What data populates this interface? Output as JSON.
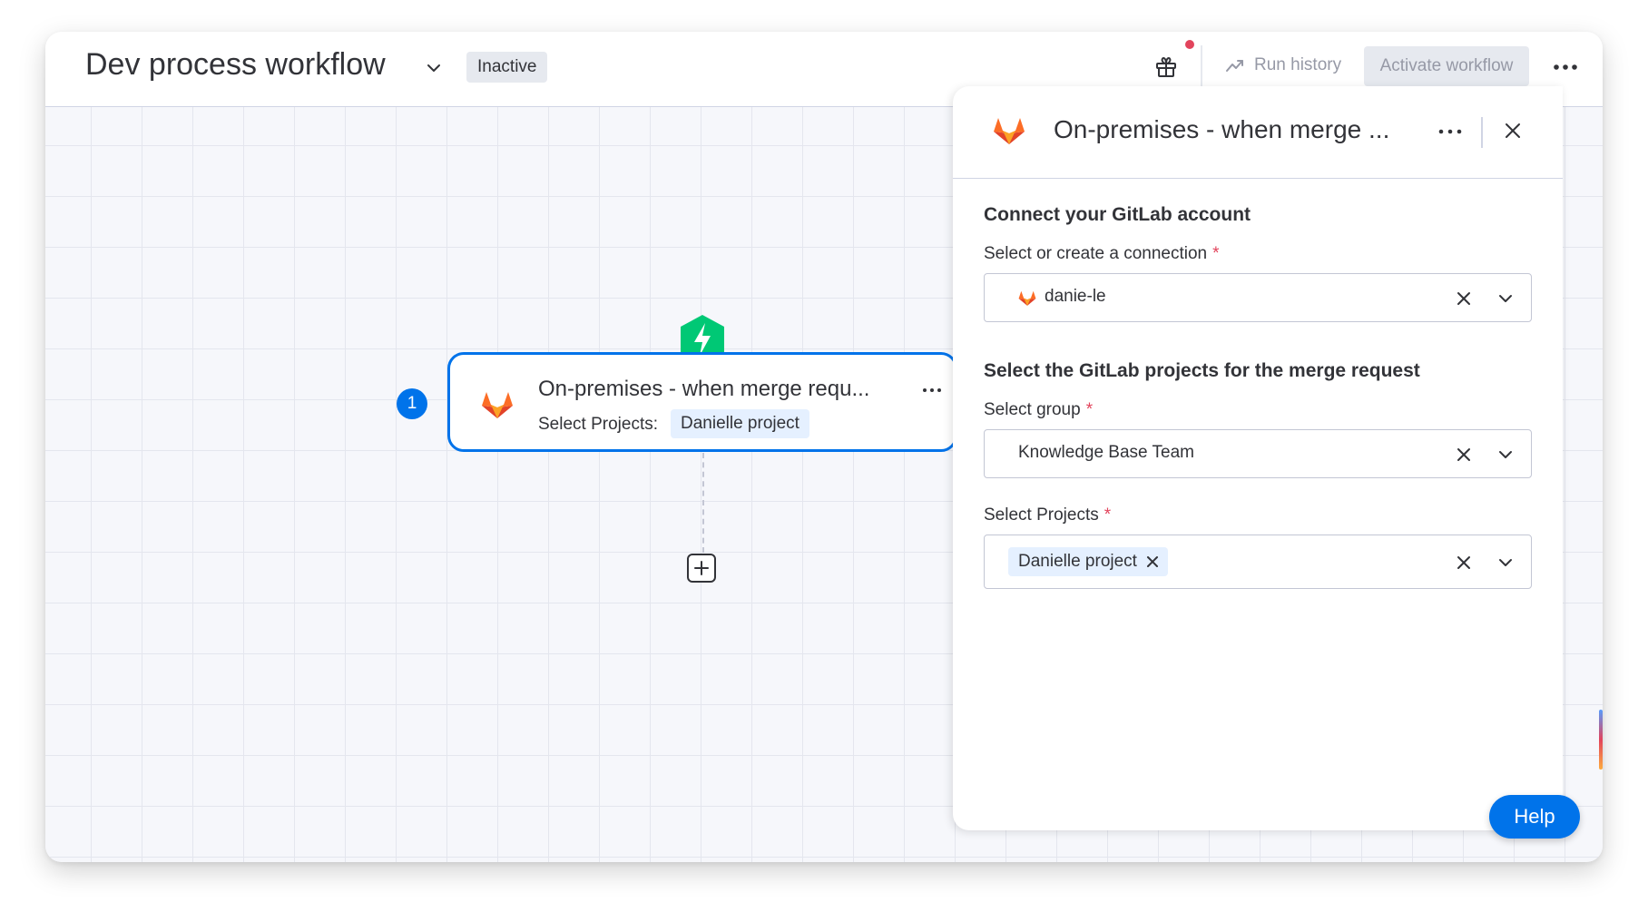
{
  "header": {
    "title": "Dev process workflow",
    "status_badge": "Inactive",
    "run_history_label": "Run history",
    "activate_label": "Activate workflow"
  },
  "canvas": {
    "step_number": "1",
    "node": {
      "title": "On-premises - when merge requ...",
      "subtitle_label": "Select Projects:",
      "chip": "Danielle project"
    }
  },
  "panel": {
    "title": "On-premises - when merge ...",
    "section_connect": "Connect your GitLab account",
    "connection_label": "Select or create a connection",
    "connection_value": "danie-le",
    "section_projects": "Select the GitLab projects for the merge request",
    "group_label": "Select group",
    "group_value": "Knowledge Base Team",
    "projects_label": "Select Projects",
    "projects_chip": "Danielle project",
    "required_mark": "*"
  },
  "help_label": "Help",
  "colors": {
    "accent": "#0073ea",
    "trigger_green": "#00c875",
    "required": "#e2445c",
    "gitlab_orange": "#fc6d26"
  },
  "icons": [
    "chevron-down-icon",
    "gift-icon",
    "run-history-icon",
    "more-horizontal-icon",
    "gitlab-icon",
    "lightning-icon",
    "plus-icon",
    "close-icon"
  ]
}
